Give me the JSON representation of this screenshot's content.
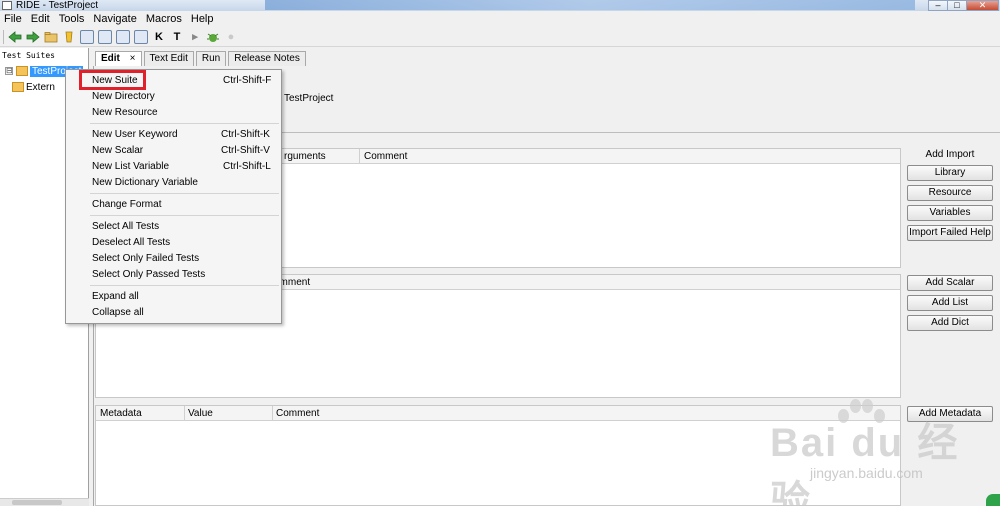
{
  "window": {
    "title": "RIDE - TestProject",
    "min": "–",
    "max": "□",
    "close": "✕"
  },
  "menubar": [
    "File",
    "Edit",
    "Tools",
    "Navigate",
    "Macros",
    "Help"
  ],
  "toolbar_icons": [
    "back-arrow-icon",
    "forward-arrow-icon",
    "open-folder-icon",
    "open-directory-icon",
    "save-icon",
    "save-all-icon",
    "search-keyword-icon",
    "keyword-icon",
    "test-case-icon",
    "run-icon",
    "bug-icon",
    "stop-icon"
  ],
  "toolbar_glyphs": {
    "keyword": "K",
    "test": "T",
    "run": "▸",
    "stop": "●"
  },
  "tree": {
    "title": "Test Suites",
    "expander": "⊟",
    "items": [
      {
        "label": "TestProject",
        "selected": true
      },
      {
        "label": "Extern"
      }
    ]
  },
  "tabs": [
    {
      "label": "Edit",
      "active": true,
      "close": "×"
    },
    {
      "label": "Text Edit"
    },
    {
      "label": "Run"
    },
    {
      "label": "Release Notes"
    }
  ],
  "editor": {
    "source_label": "TestProject",
    "import_grid": {
      "col_args": "rguments",
      "col_comment": "Comment"
    },
    "variable_grid": {
      "col_comment": "omment"
    },
    "metadata_grid": {
      "col_metadata": "Metadata",
      "col_value": "Value",
      "col_comment": "Comment"
    }
  },
  "import_buttons": {
    "group_label": "Add Import",
    "library": "Library",
    "resource": "Resource",
    "variables": "Variables",
    "import_failed_help": "Import Failed Help"
  },
  "variable_buttons": {
    "add_scalar": "Add Scalar",
    "add_list": "Add List",
    "add_dict": "Add Dict"
  },
  "metadata_buttons": {
    "add_metadata": "Add Metadata"
  },
  "context_menu": {
    "new_suite": {
      "label": "New Suite",
      "shortcut": "Ctrl-Shift-F",
      "highlighted": true
    },
    "new_directory": {
      "label": "New Directory"
    },
    "new_resource": {
      "label": "New Resource"
    },
    "new_user_keyword": {
      "label": "New User Keyword",
      "shortcut": "Ctrl-Shift-K"
    },
    "new_scalar": {
      "label": "New Scalar",
      "shortcut": "Ctrl-Shift-V"
    },
    "new_list_variable": {
      "label": "New List Variable",
      "shortcut": "Ctrl-Shift-L"
    },
    "new_dictionary_variable": {
      "label": "New Dictionary Variable"
    },
    "change_format": {
      "label": "Change Format"
    },
    "select_all_tests": {
      "label": "Select All Tests"
    },
    "deselect_all_tests": {
      "label": "Deselect All Tests"
    },
    "select_only_failed": {
      "label": "Select Only Failed Tests"
    },
    "select_only_passed": {
      "label": "Select Only Passed Tests"
    },
    "expand_all": {
      "label": "Expand all"
    },
    "collapse_all": {
      "label": "Collapse all"
    }
  },
  "watermark": {
    "logo": "Bai du 经验",
    "url": "jingyan.baidu.com"
  },
  "colors": {
    "selection": "#3399ff",
    "highlight_box": "#e0202a",
    "folder": "#f4c35a"
  }
}
